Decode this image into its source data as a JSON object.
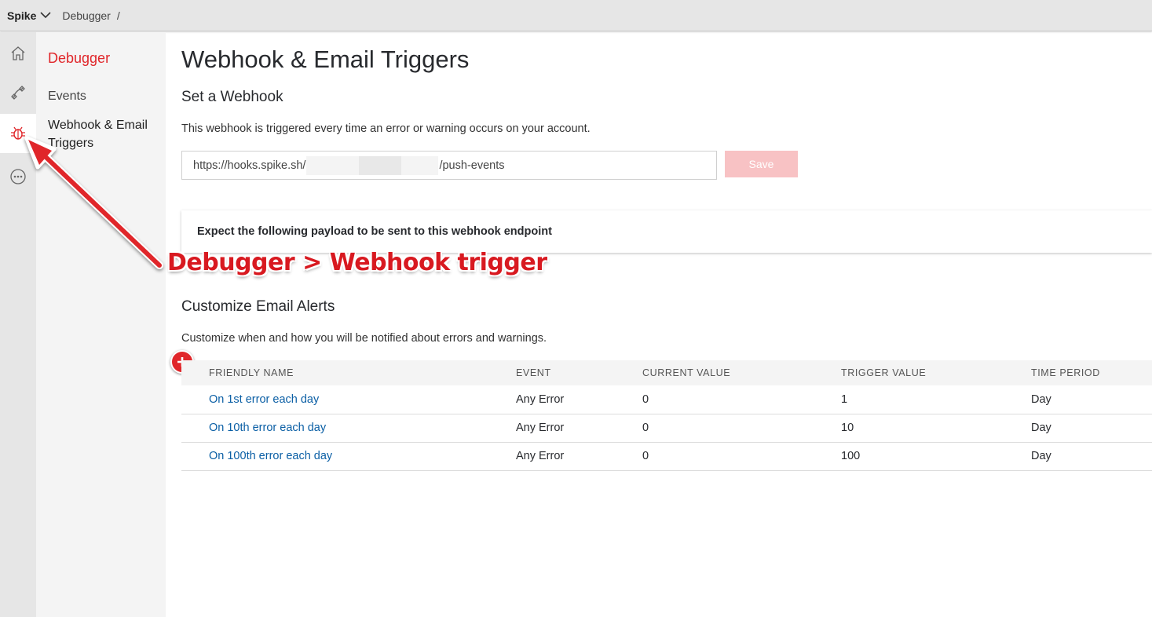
{
  "topbar": {
    "account": "Spike",
    "breadcrumb": "Debugger",
    "breadcrumb_sep": "/"
  },
  "rail": {
    "items": [
      {
        "icon": "home-icon"
      },
      {
        "icon": "phone-icon"
      },
      {
        "icon": "bug-icon",
        "active": true
      },
      {
        "icon": "more-icon"
      }
    ]
  },
  "subnav": {
    "title": "Debugger",
    "items": [
      {
        "label": "Events"
      },
      {
        "label": "Webhook & Email Triggers",
        "active": true
      }
    ]
  },
  "page": {
    "title": "Webhook & Email Triggers",
    "webhook": {
      "heading": "Set a Webhook",
      "description": "This webhook is triggered every time an error or warning occurs on your account.",
      "url_prefix": "https://hooks.spike.sh/",
      "url_suffix": "/push-events",
      "save_label": "Save"
    },
    "payload_label": "Expect the following payload to be sent to this webhook endpoint",
    "email": {
      "heading": "Customize Email Alerts",
      "description": "Customize when and how you will be notified about errors and warnings.",
      "columns": [
        "FRIENDLY NAME",
        "EVENT",
        "CURRENT VALUE",
        "TRIGGER VALUE",
        "TIME PERIOD"
      ],
      "rows": [
        {
          "name": "On 1st error each day",
          "event": "Any Error",
          "current": "0",
          "trigger": "1",
          "period": "Day"
        },
        {
          "name": "On 10th error each day",
          "event": "Any Error",
          "current": "0",
          "trigger": "10",
          "period": "Day"
        },
        {
          "name": "On 100th error each day",
          "event": "Any Error",
          "current": "0",
          "trigger": "100",
          "period": "Day"
        }
      ]
    }
  },
  "annotation": "Debugger > Webhook trigger",
  "colors": {
    "accent": "#e0262a",
    "link": "#0b5fa5",
    "save_disabled": "#f8c2c4",
    "annotation": "#d81920"
  }
}
